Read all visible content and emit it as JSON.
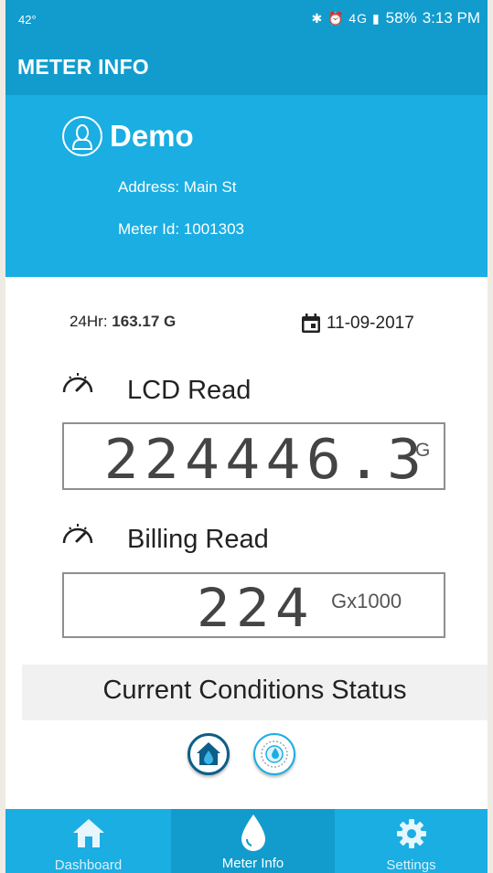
{
  "statusbar": {
    "temperature": "42°",
    "icons": "✱ ⏰ 4G ▮",
    "battery": "58%",
    "time": "3:13 PM"
  },
  "appbar": {
    "title": "METER INFO"
  },
  "account": {
    "name": "Demo",
    "address": "Address: Main St",
    "meter_id": "Meter Id: 1001303",
    "icon": "user-icon"
  },
  "summary": {
    "hr24_label": "24Hr: ",
    "hr24_value": "163.17 G",
    "date": "11-09-2017",
    "date_icon": "calendar-icon"
  },
  "lcd": {
    "label": "LCD Read",
    "value": "224446.3",
    "unit": "G",
    "icon": "gauge-icon"
  },
  "billing": {
    "label": "Billing Read",
    "value": "224",
    "unit": "Gx1000",
    "icon": "gauge-icon"
  },
  "conditions": {
    "title": "Current Conditions Status",
    "buttons": [
      "home-water-icon",
      "meter-dial-icon"
    ]
  },
  "nav": {
    "items": [
      {
        "label": "Dashboard",
        "icon": "home-icon",
        "active": false
      },
      {
        "label": "Meter Info",
        "icon": "water-drop-icon",
        "active": true
      },
      {
        "label": "Settings",
        "icon": "gear-icon",
        "active": false
      }
    ]
  },
  "colors": {
    "primary": "#119ccd",
    "header": "#1aaee3",
    "status_button": "#0c5f88"
  }
}
